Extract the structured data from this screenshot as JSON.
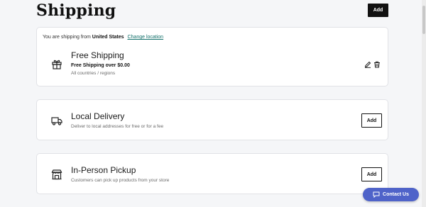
{
  "header": {
    "title": "Shipping",
    "add_label": "Add"
  },
  "origin": {
    "prefix": "You are shipping from",
    "country": "United States",
    "change_label": "Change location"
  },
  "options": [
    {
      "title": "Free Shipping",
      "rule": "Free Shipping over $0.00",
      "description": "All countries / regions",
      "icon": "gift-icon"
    },
    {
      "title": "Local Delivery",
      "description": "Deliver to local addresses for free or for a fee",
      "add_label": "Add",
      "icon": "truck-icon"
    },
    {
      "title": "In-Person Pickup",
      "description": "Customers can pick up products from your store",
      "add_label": "Add",
      "icon": "store-icon"
    }
  ],
  "contact": {
    "label": "Contact Us",
    "color": "#4f63c9"
  }
}
